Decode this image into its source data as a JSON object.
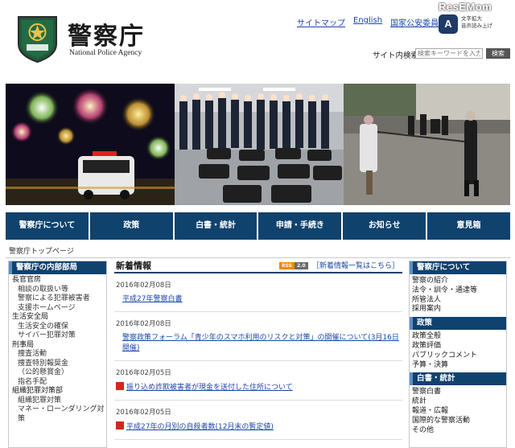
{
  "watermark": "ResEMom",
  "header": {
    "title_jp": "警察庁",
    "title_en": "National Police Agency",
    "links": [
      "サイトマップ",
      "English",
      "国家公安委員会"
    ],
    "accessibility_label_line1": "文字拡大",
    "accessibility_label_line2": "音声読み上げ",
    "accessibility_icon_text": "A",
    "search_label": "サイト内検索",
    "search_placeholder": "検索キーワードを入力",
    "search_button": "検索"
  },
  "nav": {
    "items": [
      "警察庁について",
      "政策",
      "白書・統計",
      "申請・手続き",
      "お知らせ",
      "意見箱"
    ]
  },
  "breadcrumb": "警察庁トップページ",
  "left_sidebar": {
    "heading": "警察庁の内部部局",
    "items": [
      {
        "label": "長官官房",
        "sub": false
      },
      {
        "label": "相談の取扱い等",
        "sub": true
      },
      {
        "label": "警察による犯罪被害者",
        "sub": true
      },
      {
        "label": "支援ホームページ",
        "sub": true
      },
      {
        "label": "生活安全局",
        "sub": false
      },
      {
        "label": "生活安全の確保",
        "sub": true
      },
      {
        "label": "サイバー犯罪対策",
        "sub": true
      },
      {
        "label": "刑事局",
        "sub": false
      },
      {
        "label": "捜査活動",
        "sub": true
      },
      {
        "label": "捜査特別報奨金",
        "sub": true
      },
      {
        "label": "（公的懸賞金）",
        "sub": true
      },
      {
        "label": "指名手配",
        "sub": true
      },
      {
        "label": "組織犯罪対策部",
        "sub": false
      },
      {
        "label": "組織犯罪対策",
        "sub": true
      },
      {
        "label": "マネー・ローンダリング対策",
        "sub": true
      }
    ]
  },
  "news": {
    "heading": "新着情報",
    "rss": [
      "RSS",
      "2.0"
    ],
    "list_link": "［新着情報一覧はこちら］",
    "items": [
      {
        "date": "2016年02月08日",
        "title": "平成27年警察白書",
        "flag": false
      },
      {
        "date": "2016年02月08日",
        "title": "警察政策フォーラム「青少年のスマホ利用のリスクと対策」の開催について(3月16日開催)",
        "flag": false
      },
      {
        "date": "2016年02月05日",
        "title": "振り込め詐欺被害者が現金を送付した住所について",
        "flag": true
      },
      {
        "date": "2016年02月05日",
        "title": "平成27年の月別の自殺者数(12月末の暫定値)",
        "flag": true
      }
    ]
  },
  "right_sidebar": {
    "sections": [
      {
        "heading": "警察庁について",
        "items": [
          "警察の紹介",
          "法令・訓令・通達等",
          "所管法人",
          "採用案内"
        ]
      },
      {
        "heading": "政策",
        "items": [
          "政策全般",
          "政策評価",
          "パブリックコメント",
          "予算・決算"
        ]
      },
      {
        "heading": "白書・統計",
        "items": [
          "警察白書",
          "統計",
          "報道・広報",
          "国際的な警察活動",
          "その他"
        ]
      }
    ]
  },
  "colors": {
    "nav_bg": "#10426e",
    "link": "#1a47a8",
    "flag_red": "#d0281c"
  }
}
